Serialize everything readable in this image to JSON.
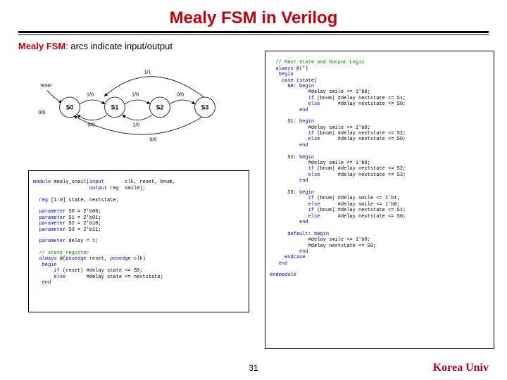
{
  "title": "Mealy FSM in Verilog",
  "subtitle_prefix": "Mealy FSM",
  "subtitle_rest": ": arcs indicate input/output",
  "diagram": {
    "reset": "reset",
    "states": [
      "S0",
      "S1",
      "S2",
      "S3"
    ],
    "arcs": {
      "top_loop": "1/1",
      "s0_s1": "1/0",
      "s1_s2": "1/0",
      "s2_s3": "0/0",
      "reset_in": "0/0",
      "s1_s0": "0/0",
      "s2_s1": "1/0",
      "s3_s1": "0/0"
    }
  },
  "code_left": "module mealy_snail(input       clk, reset, bnum,\n                   output reg  smile);\n\n  reg [1:0] state, nextstate;\n\n  parameter S0 = 2'b00;\n  parameter S1 = 2'b01;\n  parameter S2 = 2'b10;\n  parameter S3 = 2'b11;\n\n  parameter delay = 1;\n\n  // state register\n  always @(posedge reset, posedge clk)\n   begin\n       if (reset) #delay state <= S0;\n       else       #delay state <= nextstate;\n   end",
  "code_right": "  // Next State and Output Logic\n  always @(*)\n   begin\n    case (state)\n      S0: begin\n             #delay smile <= 1'b0;\n             if (bnum) #delay nextstate <= S1;\n             else      #delay nextstate <= S0;\n          end\n\n      S1: begin\n             #delay smile <= 1'b0;\n             if (bnum) #delay nextstate <= S2;\n             else      #delay nextstate <= S0;\n          end\n\n      S2: begin\n             #delay smile <= 1'b0;\n             if (bnum) #delay nextstate <= S2;\n             else      #delay nextstate <= S3;\n          end\n\n      S3: begin\n             if (bnum) #delay smile <= 1'b1;\n             else      #delay smile <= 1'b0;\n             if (bnum) #delay nextstate <= S1;\n             else      #delay nextstate <= S0;\n          end\n\n      default: begin\n             #delay smile <= 1'b0;\n             #delay nextstate <= S0;\n          end\n     endcase\n   end\n\nendmodule",
  "page_number": "31",
  "footer": "Korea Univ"
}
